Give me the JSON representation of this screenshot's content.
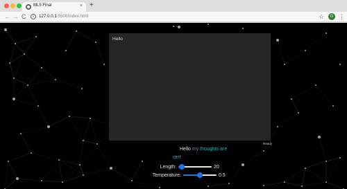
{
  "browser": {
    "tab_title": "ML5 Final",
    "tab_close": "×",
    "new_tab": "+",
    "url_host": "127.0.0.1",
    "url_path": ":5500/index.html",
    "info_icon": "i",
    "back": "←",
    "forward": "→",
    "reload": "C",
    "star": "☆",
    "avatar_letter": "G",
    "menu": "⋮",
    "colors": {
      "close": "#fd5f57",
      "minimize": "#febc2e",
      "maximize": "#28c840",
      "avatar": "#2e7d32"
    }
  },
  "page": {
    "output_text": "Hello",
    "status": "Ready",
    "generated": {
      "seed": "Hello",
      "continuation": "my thoughts are",
      "continuation_line2": "cert"
    },
    "controls": {
      "length": {
        "label": "Length:",
        "value": "20",
        "fraction": 0.1
      },
      "temperature": {
        "label": "Temperature:",
        "value": "0.5",
        "fraction": 0.5
      }
    },
    "colors": {
      "background": "#000000",
      "panel": "#262626",
      "accent": "#21b6c8",
      "slider": "#1a73e8"
    },
    "background_icon": "particle-network"
  }
}
